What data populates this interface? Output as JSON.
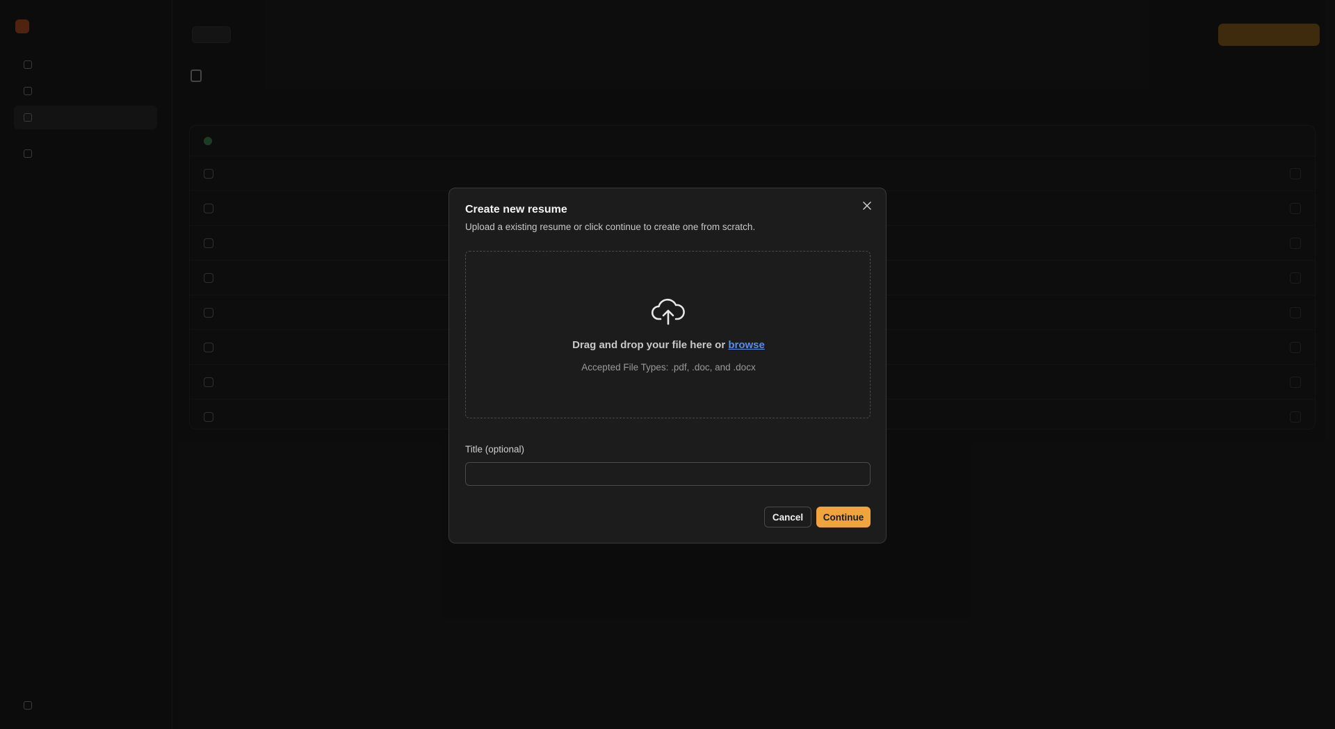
{
  "modal": {
    "title": "Create new resume",
    "subtitle": "Upload a existing resume or click continue to create one from scratch.",
    "close_icon": "close-icon",
    "dropzone": {
      "icon": "cloud-upload-icon",
      "text_prefix": "Drag and drop your file here or",
      "browse_label": "browse",
      "hint": "Accepted File Types: .pdf, .doc, and .docx"
    },
    "title_field": {
      "label": "Title (optional)",
      "value": "",
      "placeholder": ""
    },
    "cancel_label": "Cancel",
    "continue_label": "Continue"
  },
  "colors": {
    "accent": "#f0a43e",
    "link": "#5a8ee6",
    "modal_bg": "#1c1c1c"
  }
}
